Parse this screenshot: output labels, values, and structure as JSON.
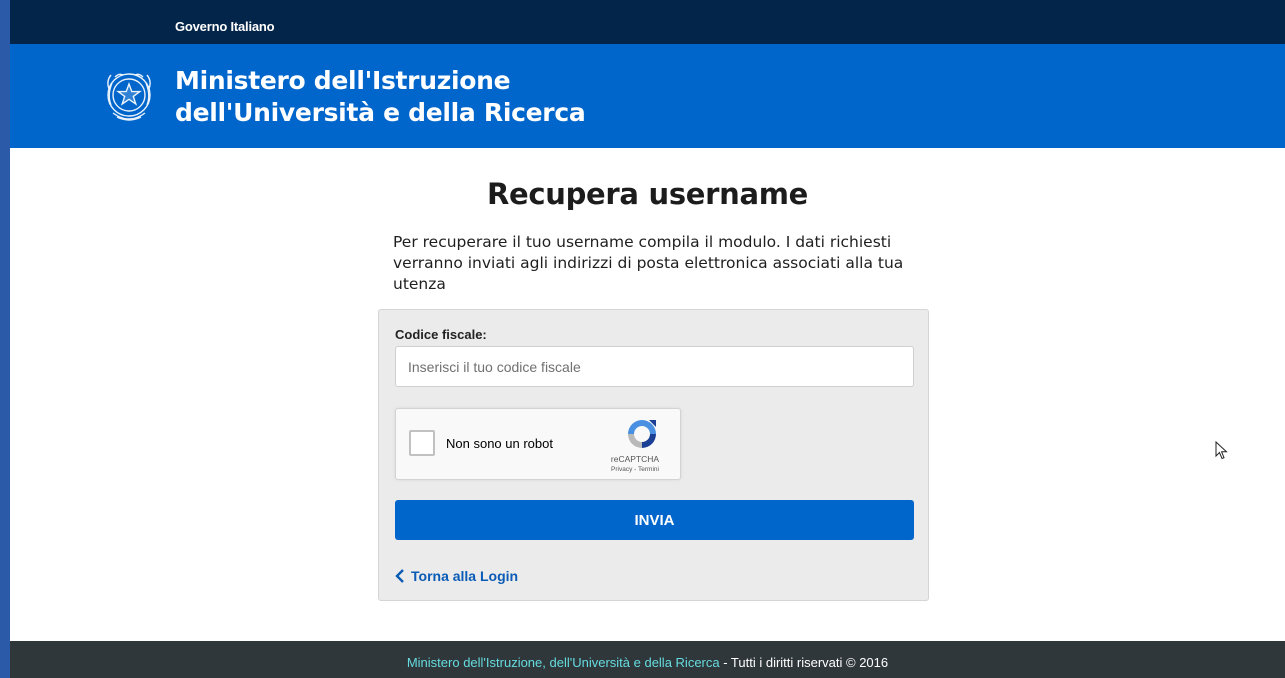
{
  "gov_bar": {
    "label": "Governo Italiano"
  },
  "header": {
    "title_line1": "Ministero dell'Istruzione",
    "title_line2": "dell'Università e della Ricerca",
    "emblem_icon": "italian-republic-emblem-icon"
  },
  "main": {
    "title": "Recupera username",
    "intro": "Per recuperare il tuo username compila il modulo. I dati richiesti verranno inviati agli indirizzi di posta elettronica associati alla tua utenza"
  },
  "form": {
    "codice_fiscale_label": "Codice fiscale:",
    "codice_fiscale_placeholder": "Inserisci il tuo codice fiscale",
    "codice_fiscale_value": "",
    "recaptcha": {
      "label": "Non sono un robot",
      "brand": "reCAPTCHA",
      "links": "Privacy - Termini",
      "checked": false
    },
    "submit_label": "INVIA",
    "back_link_label": "Torna alla Login"
  },
  "footer": {
    "ministry_link": "Ministero dell'Istruzione, dell'Università e della Ricerca",
    "rights": " - Tutti i diritti riservati © 2016"
  },
  "colors": {
    "gov_bar": "#04254a",
    "header_blue": "#0066cc",
    "footer_bg": "#30373b",
    "footer_link": "#65dcdf",
    "form_bg": "#ebebeb"
  }
}
